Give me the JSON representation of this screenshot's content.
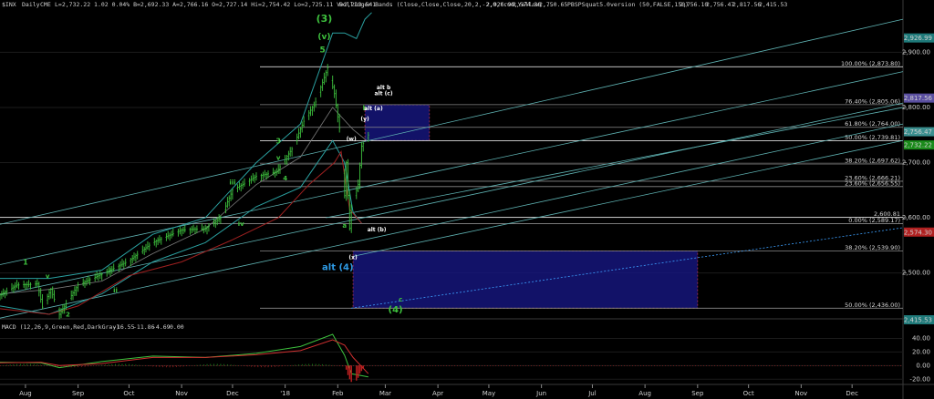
{
  "header": {
    "symbol": "$INX",
    "interval": "Daily",
    "exchange": "CME",
    "quote": "L=2,732.22 1.02 0.04% B=2,692.33 A=2,766.16 O=2,727.14 Hi=2,754.42 Lo=2,725.11 V=2,213,541",
    "bollinger_label": "Bollinger Bands (Close,Close,Close,20,2,-2,0,true,Yellow,...",
    "bollinger_values": [
      "2,926.99",
      "2,574.30",
      "2,750.65"
    ],
    "squeeze_label": "PBSPSquat5.0version (50,FALSE,150)",
    "squeeze_values": [
      "2,756.10",
      "2,756.47",
      "2,817.56",
      "2,415.53"
    ]
  },
  "macd": {
    "label": "MACD (12,26,9,Green,Red,DarkGray)",
    "values": [
      "-16.55",
      "-11.86",
      "-4.69",
      "0.00"
    ],
    "axis_ticks": [
      {
        "value": 40,
        "text": "40.00"
      },
      {
        "value": 20,
        "text": "20.00"
      },
      {
        "value": 0,
        "text": "0.00"
      },
      {
        "value": -20,
        "text": "-20.00"
      }
    ]
  },
  "chart_data": {
    "type": "line",
    "title": "",
    "ylabel": "",
    "ylim": [
      2420,
      2975
    ],
    "x_range": [
      "2017-07-17",
      "2018-12-31"
    ],
    "y_ticks": [
      {
        "value": 2900,
        "text": "2,900.00"
      },
      {
        "value": 2800,
        "text": "2,800.00"
      },
      {
        "value": 2700,
        "text": "2,700.00"
      },
      {
        "value": 2600,
        "text": "2,600.00"
      },
      {
        "value": 2500,
        "text": "2,500.00"
      }
    ],
    "x_ticks": [
      {
        "date": "2017-08-01",
        "text": "Aug"
      },
      {
        "date": "2017-09-01",
        "text": "Sep"
      },
      {
        "date": "2017-10-01",
        "text": "Oct"
      },
      {
        "date": "2017-11-01",
        "text": "Nov"
      },
      {
        "date": "2017-12-01",
        "text": "Dec"
      },
      {
        "date": "2018-01-01",
        "text": "'18"
      },
      {
        "date": "2018-02-01",
        "text": "Feb"
      },
      {
        "date": "2018-03-01",
        "text": "Mar"
      },
      {
        "date": "2018-04-01",
        "text": "Apr"
      },
      {
        "date": "2018-05-01",
        "text": "May"
      },
      {
        "date": "2018-06-01",
        "text": "Jun"
      },
      {
        "date": "2018-07-01",
        "text": "Jul"
      },
      {
        "date": "2018-08-01",
        "text": "Aug"
      },
      {
        "date": "2018-09-01",
        "text": "Sep"
      },
      {
        "date": "2018-10-01",
        "text": "Oct"
      },
      {
        "date": "2018-11-01",
        "text": "Nov"
      },
      {
        "date": "2018-12-01",
        "text": "Dec"
      }
    ],
    "price_path": [
      [
        "2017-07-17",
        2460
      ],
      [
        "2017-07-27",
        2478
      ],
      [
        "2017-08-08",
        2480
      ],
      [
        "2017-08-11",
        2438
      ],
      [
        "2017-08-16",
        2470
      ],
      [
        "2017-08-21",
        2425
      ],
      [
        "2017-09-01",
        2478
      ],
      [
        "2017-09-11",
        2492
      ],
      [
        "2017-09-20",
        2505
      ],
      [
        "2017-10-01",
        2522
      ],
      [
        "2017-10-15",
        2555
      ],
      [
        "2017-11-01",
        2578
      ],
      [
        "2017-11-15",
        2580
      ],
      [
        "2017-11-24",
        2600
      ],
      [
        "2017-12-01",
        2650
      ],
      [
        "2017-12-15",
        2675
      ],
      [
        "2017-12-27",
        2683
      ],
      [
        "2018-01-05",
        2725
      ],
      [
        "2018-01-12",
        2775
      ],
      [
        "2018-01-19",
        2810
      ],
      [
        "2018-01-26",
        2872
      ],
      [
        "2018-01-30",
        2825
      ],
      [
        "2018-02-02",
        2762
      ],
      [
        "2018-02-05",
        2640
      ],
      [
        "2018-02-06",
        2700
      ],
      [
        "2018-02-08",
        2581
      ],
      [
        "2018-02-09",
        2620
      ],
      [
        "2018-02-13",
        2660
      ],
      [
        "2018-02-15",
        2730
      ],
      [
        "2018-02-19",
        2750
      ]
    ],
    "bollinger_upper": [
      [
        "2017-07-17",
        2490
      ],
      [
        "2017-08-15",
        2490
      ],
      [
        "2017-09-15",
        2505
      ],
      [
        "2017-10-15",
        2570
      ],
      [
        "2017-11-15",
        2600
      ],
      [
        "2017-12-15",
        2700
      ],
      [
        "2018-01-10",
        2770
      ],
      [
        "2018-01-29",
        2935
      ],
      [
        "2018-02-05",
        2935
      ],
      [
        "2018-02-12",
        2925
      ],
      [
        "2018-02-17",
        2960
      ],
      [
        "2018-02-21",
        2972
      ]
    ],
    "bollinger_lower": [
      [
        "2017-07-17",
        2440
      ],
      [
        "2017-08-15",
        2425
      ],
      [
        "2017-09-15",
        2462
      ],
      [
        "2017-10-15",
        2520
      ],
      [
        "2017-11-15",
        2555
      ],
      [
        "2017-12-15",
        2620
      ],
      [
        "2018-01-10",
        2655
      ],
      [
        "2018-01-29",
        2740
      ],
      [
        "2018-02-05",
        2700
      ],
      [
        "2018-02-10",
        2610
      ],
      [
        "2018-02-15",
        2590
      ]
    ],
    "squeeze_line": [
      [
        "2017-07-17",
        2462
      ],
      [
        "2017-08-15",
        2470
      ],
      [
        "2017-09-15",
        2485
      ],
      [
        "2017-10-15",
        2535
      ],
      [
        "2017-11-15",
        2580
      ],
      [
        "2017-12-15",
        2660
      ],
      [
        "2018-01-10",
        2710
      ],
      [
        "2018-01-29",
        2800
      ],
      [
        "2018-02-10",
        2760
      ],
      [
        "2018-02-18",
        2740
      ]
    ],
    "red_line": [
      [
        "2017-07-17",
        2435
      ],
      [
        "2017-08-15",
        2425
      ],
      [
        "2017-09-01",
        2440
      ],
      [
        "2017-10-01",
        2495
      ],
      [
        "2017-11-01",
        2520
      ],
      [
        "2017-12-01",
        2560
      ],
      [
        "2017-12-28",
        2600
      ],
      [
        "2018-01-15",
        2660
      ],
      [
        "2018-01-30",
        2700
      ],
      [
        "2018-02-03",
        2720
      ],
      [
        "2018-02-08",
        2615
      ],
      [
        "2018-02-15",
        2590
      ]
    ],
    "horizontal_lines": [
      {
        "y": 2873.8,
        "label": "100.00% (2,873.80)",
        "color": "#ffffff"
      },
      {
        "y": 2805.06,
        "label": "76.40% (2,805.06)",
        "color": "#8a8a8a"
      },
      {
        "y": 2764.0,
        "label": "61.80% (2,764.00)",
        "color": "#8a8a8a"
      },
      {
        "y": 2739.81,
        "label": "50.00% (2,739.81)",
        "color": "#ffffff"
      },
      {
        "y": 2697.62,
        "label": "38.20% (2,697.62)",
        "color": "#8a8a8a"
      },
      {
        "y": 2666.21,
        "label": "23.60% (2,666.21)",
        "color": "#8a8a8a"
      },
      {
        "y": 2656.55,
        "label": "23.60% (2,656.55)",
        "color": "#8a8a8a"
      },
      {
        "y": 2600.81,
        "label": "2,600.81",
        "color": "#ffffff"
      },
      {
        "y": 2589.17,
        "label": "0.00% (2,589.17)",
        "color": "#8a8a8a"
      },
      {
        "y": 2539.9,
        "label": "38.20% (2,539.90)",
        "color": "#8a8a8a"
      },
      {
        "y": 2436.0,
        "label": "50.00% (2,436.00)",
        "color": "#8a8a8a"
      }
    ],
    "boxes": [
      {
        "from": "2018-02-17",
        "to": "2018-03-27",
        "y_top": 2805,
        "y_bottom": 2740
      },
      {
        "from": "2018-02-10",
        "to": "2018-09-01",
        "y_top": 2539.9,
        "y_bottom": 2436
      }
    ],
    "channels": [
      {
        "from": [
          "2017-07-17",
          2588
        ],
        "to": [
          "2018-12-31",
          2960
        ],
        "color": "#5fb3b3"
      },
      {
        "from": [
          "2017-07-17",
          2515
        ],
        "to": [
          "2018-12-31",
          2865
        ],
        "color": "#5fb3b3"
      },
      {
        "from": [
          "2017-07-17",
          2460
        ],
        "to": [
          "2018-12-31",
          2808
        ],
        "color": "#5fb3b3"
      },
      {
        "from": [
          "2017-07-17",
          2418
        ],
        "to": [
          "2018-12-31",
          2770
        ],
        "color": "#5fb3b3"
      },
      {
        "from": [
          "2018-01-25",
          2600
        ],
        "to": [
          "2018-12-31",
          2800
        ],
        "color": "#5fb3b3"
      },
      {
        "from": [
          "2018-02-10",
          2530
        ],
        "to": [
          "2018-12-31",
          2740
        ],
        "color": "#5fb3b3"
      }
    ],
    "blue_dashed_line": {
      "from": [
        "2018-02-09",
        2436
      ],
      "to": [
        "2018-12-31",
        2582
      ],
      "color": "#3da0ff"
    },
    "price_right_tags": [
      {
        "value": 2926,
        "text": "2,926.99",
        "color": "#1f7a7a"
      },
      {
        "value": 2817,
        "text": "2,817.56",
        "color": "#5a4fa0"
      },
      {
        "value": 2756,
        "text": "2,756.47",
        "color": "#3b8f8f"
      },
      {
        "value": 2732,
        "text": "2,732.22",
        "color": "#1a8a1a"
      },
      {
        "value": 2574,
        "text": "2,574.30",
        "color": "#b02020"
      },
      {
        "value": 2415,
        "text": "2,415.53",
        "color": "#1f7a7a"
      }
    ],
    "wave_labels": [
      {
        "date": "2018-01-24",
        "y": 2955,
        "text": "(3)",
        "color": "#3ec23e",
        "size": 11
      },
      {
        "date": "2018-01-24",
        "y": 2924,
        "text": "(v)",
        "color": "#3ec23e",
        "size": 9
      },
      {
        "date": "2018-01-23",
        "y": 2900,
        "text": "5",
        "color": "#3ec23e",
        "size": 9
      },
      {
        "date": "2017-08-01",
        "y": 2515,
        "text": "1",
        "color": "#3ec23e",
        "size": 8
      },
      {
        "date": "2017-08-14",
        "y": 2490,
        "text": "v",
        "color": "#3ec23e",
        "size": 7
      },
      {
        "date": "2017-09-20",
        "y": 2503,
        "text": "i",
        "color": "#3ec23e",
        "size": 7
      },
      {
        "date": "2017-09-23",
        "y": 2465,
        "text": "ii",
        "color": "#3ec23e",
        "size": 7
      },
      {
        "date": "2017-12-01",
        "y": 2660,
        "text": "iii",
        "color": "#3ec23e",
        "size": 7
      },
      {
        "date": "2017-12-06",
        "y": 2585,
        "text": "iv",
        "color": "#3ec23e",
        "size": 7
      },
      {
        "date": "2017-12-28",
        "y": 2735,
        "text": "3",
        "color": "#3ec23e",
        "size": 8
      },
      {
        "date": "2017-12-28",
        "y": 2705,
        "text": "v",
        "color": "#3ec23e",
        "size": 7
      },
      {
        "date": "2018-01-01",
        "y": 2668,
        "text": "4",
        "color": "#3ec23e",
        "size": 7
      },
      {
        "date": "2017-08-26",
        "y": 2421,
        "text": "2",
        "color": "#3ec23e",
        "size": 7
      },
      {
        "date": "2018-02-05",
        "y": 2582,
        "text": "a",
        "color": "#3ec23e",
        "size": 7
      },
      {
        "date": "2018-02-17",
        "y": 2795,
        "text": "b",
        "color": "#3ec23e",
        "size": 7
      },
      {
        "date": "2018-03-10",
        "y": 2448,
        "text": "c",
        "color": "#3ec23e",
        "size": 7
      },
      {
        "date": "2018-03-07",
        "y": 2428,
        "text": "(4)",
        "color": "#3ec23e",
        "size": 10
      },
      {
        "date": "2018-02-09",
        "y": 2740,
        "text": "(w)",
        "color": "#ffffff",
        "size": 6
      },
      {
        "date": "2018-02-17",
        "y": 2776,
        "text": "(y)",
        "color": "#ffffff",
        "size": 6
      },
      {
        "date": "2018-02-10",
        "y": 2525,
        "text": "(x)",
        "color": "#ffffff",
        "size": 6
      },
      {
        "date": "2018-02-22",
        "y": 2795,
        "text": "alt (a)",
        "color": "#ffffff",
        "size": 6
      },
      {
        "date": "2018-02-28",
        "y": 2833,
        "text": "alt b",
        "color": "#ffffff",
        "size": 6
      },
      {
        "date": "2018-02-28",
        "y": 2822,
        "text": "alt (c)",
        "color": "#ffffff",
        "size": 6
      },
      {
        "date": "2018-02-24",
        "y": 2575,
        "text": "alt (b)",
        "color": "#ffffff",
        "size": 6
      },
      {
        "date": "2018-02-01",
        "y": 2505,
        "text": "alt (4)",
        "color": "#2e9be6",
        "size": 10
      }
    ],
    "macd_line": [
      [
        "2017-07-17",
        5
      ],
      [
        "2017-08-10",
        4
      ],
      [
        "2017-08-21",
        -3
      ],
      [
        "2017-09-15",
        6
      ],
      [
        "2017-10-15",
        14
      ],
      [
        "2017-11-15",
        12
      ],
      [
        "2017-12-15",
        18
      ],
      [
        "2018-01-10",
        28
      ],
      [
        "2018-01-29",
        46
      ],
      [
        "2018-02-05",
        15
      ],
      [
        "2018-02-09",
        -12
      ],
      [
        "2018-02-19",
        -16.55
      ]
    ],
    "macd_signal": [
      [
        "2017-07-17",
        4
      ],
      [
        "2017-08-10",
        5
      ],
      [
        "2017-08-21",
        0
      ],
      [
        "2017-09-15",
        3
      ],
      [
        "2017-10-15",
        12
      ],
      [
        "2017-11-15",
        12
      ],
      [
        "2017-12-15",
        16
      ],
      [
        "2018-01-10",
        22
      ],
      [
        "2018-01-29",
        38
      ],
      [
        "2018-02-05",
        30
      ],
      [
        "2018-02-10",
        12
      ],
      [
        "2018-02-19",
        -11.86
      ]
    ],
    "macd_hist_neg": [
      [
        "2018-02-06",
        -6
      ],
      [
        "2018-02-07",
        -14
      ],
      [
        "2018-02-08",
        -20
      ],
      [
        "2018-02-09",
        -24
      ],
      [
        "2018-02-12",
        -22
      ],
      [
        "2018-02-13",
        -18
      ],
      [
        "2018-02-14",
        -12
      ],
      [
        "2018-02-15",
        -8
      ],
      [
        "2018-02-16",
        -5
      ]
    ]
  }
}
